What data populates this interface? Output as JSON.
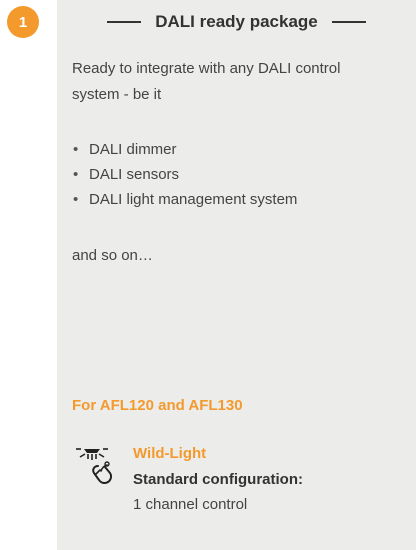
{
  "badge": {
    "number": "1"
  },
  "card": {
    "title": "DALI ready package",
    "intro": "Ready to integrate with any DALI control system - be it",
    "bullets": [
      "DALI dimmer",
      "DALI sensors",
      "DALI light management system"
    ],
    "outro": "and so on…",
    "models": "For AFL120 and AFL130",
    "product": {
      "icon": "street-light-with-sensor-icon",
      "name": "Wild-Light",
      "config_label": "Standard configuration:",
      "config_value": "1 channel control"
    }
  },
  "colors": {
    "accent": "#f49a2d",
    "card_background": "#ececea",
    "text": "#333333"
  }
}
